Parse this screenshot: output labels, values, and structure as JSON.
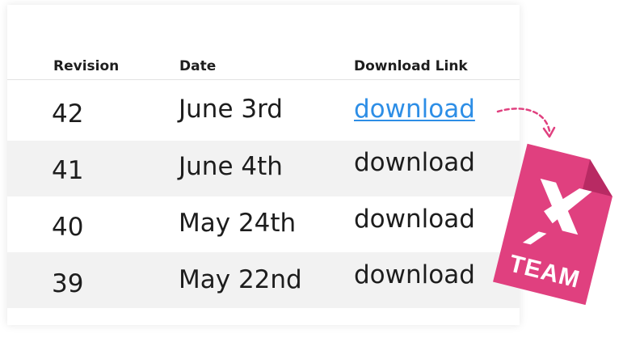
{
  "table": {
    "headers": {
      "revision": "Revision",
      "date": "Date",
      "download_link": "Download Link"
    },
    "rows": [
      {
        "revision": "42",
        "date": "June 3rd",
        "link": "download"
      },
      {
        "revision": "41",
        "date": "June 4th",
        "link": "download"
      },
      {
        "revision": "40",
        "date": "May 24th",
        "link": "download"
      },
      {
        "revision": "39",
        "date": "May 22nd",
        "link": "download"
      }
    ]
  },
  "badge": {
    "label": "TEAM",
    "icon": "x-logo-icon",
    "color": "#e0407f"
  },
  "colors": {
    "link_active": "#2d8ee6",
    "row_shade": "#f2f2f2",
    "arrow": "#e0407f"
  }
}
